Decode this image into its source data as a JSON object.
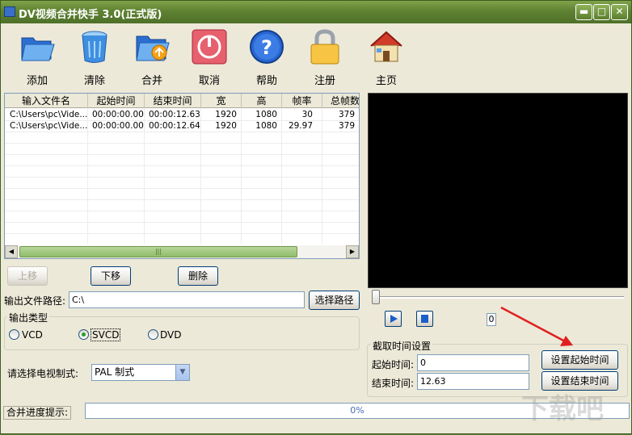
{
  "window": {
    "title": "DV视频合并快手 3.0(正式版)",
    "min_glyph": "▬",
    "max_glyph": "□",
    "close_glyph": "✕"
  },
  "toolbar": {
    "items": [
      {
        "label": "添加",
        "icon": "open-folder-icon"
      },
      {
        "label": "清除",
        "icon": "recycle-bin-icon"
      },
      {
        "label": "合并",
        "icon": "merge-folder-icon"
      },
      {
        "label": "取消",
        "icon": "stop-icon"
      },
      {
        "label": "帮助",
        "icon": "help-icon"
      },
      {
        "label": "注册",
        "icon": "lock-icon"
      },
      {
        "label": "主页",
        "icon": "home-icon"
      }
    ]
  },
  "file_list": {
    "columns": [
      "输入文件名",
      "起始时间",
      "结束时间",
      "宽",
      "高",
      "帧率",
      "总帧数"
    ],
    "rows": [
      [
        "C:\\Users\\pc\\Vide...",
        "00:00:00.00",
        "00:00:12.63",
        "1920",
        "1080",
        "30",
        "379"
      ],
      [
        "C:\\Users\\pc\\Vide...",
        "00:00:00.00",
        "00:00:12.64",
        "1920",
        "1080",
        "29.97",
        "379"
      ]
    ],
    "scroll_thumb_glyph": "|||",
    "scroll_left_glyph": "◀",
    "scroll_right_glyph": "▶"
  },
  "list_buttons": {
    "up": "上移",
    "down": "下移",
    "delete": "删除"
  },
  "output": {
    "path_label": "输出文件路径:",
    "path_value": "C:\\",
    "choose_path_button": "选择路径",
    "type_group_label": "输出类型",
    "types": [
      "VCD",
      "SVCD",
      "DVD"
    ],
    "selected_type": "SVCD",
    "tv_system_label": "请选择电视制式:",
    "tv_system_value": "PAL 制式",
    "dropdown_glyph": "▼"
  },
  "player": {
    "frame_value": "0",
    "play_glyph": "▶",
    "stop_glyph": "■"
  },
  "trim": {
    "group_label": "截取时间设置",
    "start_label": "起始时间:",
    "start_value": "0",
    "end_label": "结束时间:",
    "end_value": "12.63",
    "set_start_button": "设置起始时间",
    "set_end_button": "设置结束时间"
  },
  "status": {
    "progress_label": "合并进度提示:",
    "progress_text": "0%",
    "progress_fraction": 0
  },
  "watermark": "下载吧",
  "colors": {
    "title_green": "#5e8232",
    "annotation_arrow": "#e02020",
    "play_blue": "#1a5fc8"
  }
}
